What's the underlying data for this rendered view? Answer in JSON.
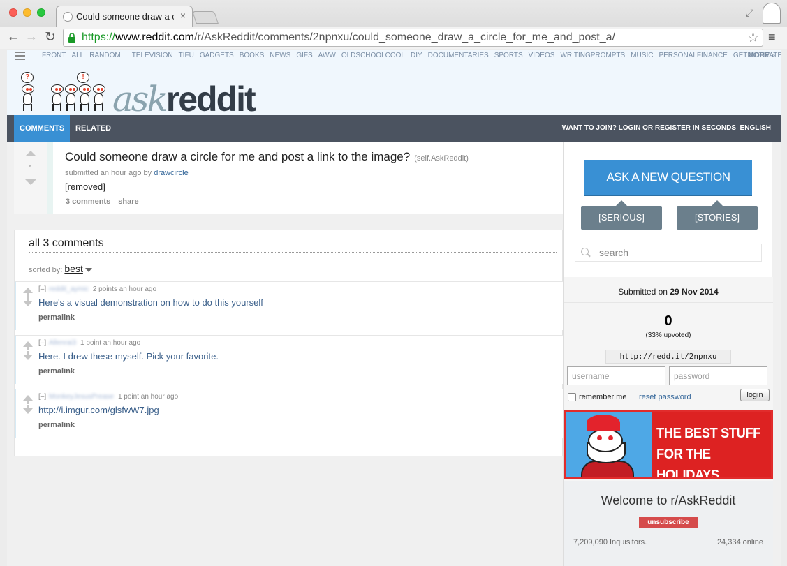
{
  "browser": {
    "tab_title": "Could someone draw a circ",
    "url": {
      "scheme": "https://",
      "host": "www.reddit.com",
      "path": "/r/AskReddit/comments/2npnxu/could_someone_draw_a_circle_for_me_and_post_a/"
    }
  },
  "subreddit_bar": {
    "items": [
      "FRONT",
      "ALL",
      "RANDOM",
      "TELEVISION",
      "TIFU",
      "GADGETS",
      "BOOKS",
      "NEWS",
      "GIFS",
      "AWW",
      "OLDSCHOOLCOOL",
      "DIY",
      "DOCUMENTARIES",
      "SPORTS",
      "VIDEOS",
      "WRITINGPROMPTS",
      "MUSIC",
      "PERSONALFINANCE",
      "GETMOTIVATED"
    ],
    "more": "MORE »"
  },
  "header": {
    "wordmark_ask": "ask",
    "wordmark_reddit": "reddit",
    "tabs": [
      "COMMENTS",
      "RELATED"
    ],
    "join": "WANT TO JOIN? LOGIN OR REGISTER IN SECONDS",
    "language": "ENGLISH"
  },
  "post": {
    "score": "•",
    "title": "Could someone draw a circle for me and post a link to the image?",
    "domain": "(self.AskReddit)",
    "submitted": "submitted an hour ago by",
    "author": "drawcircle",
    "body": "[removed]",
    "comments_link": "3 comments",
    "share_link": "share"
  },
  "comments_area": {
    "heading": "all 3 comments",
    "sorted_by_label": "sorted by:",
    "sort_value": "best",
    "comments": [
      {
        "collapse": "[–]",
        "author": "reddit_aymic",
        "points": "2 points an hour ago",
        "body": "Here's a visual demonstration on how to do this yourself",
        "permalink": "permalink"
      },
      {
        "collapse": "[–]",
        "author": "Allenrai3",
        "points": "1 point an hour ago",
        "body": "Here. I drew these myself. Pick your favorite.",
        "permalink": "permalink"
      },
      {
        "collapse": "[–]",
        "author": "MonkeyJesusPrease",
        "points": "1 point an hour ago",
        "body": "http://i.imgur.com/glsfwW7.jpg",
        "permalink": "permalink"
      }
    ]
  },
  "sidebar": {
    "ask_button": "ASK A NEW QUESTION",
    "serious_button": "[SERIOUS]",
    "stories_button": "[STORIES]",
    "search_placeholder": "search",
    "submitted_label": "Submitted on",
    "submitted_date": "29 Nov 2014",
    "score": "0",
    "upvoted": "(33% upvoted)",
    "shortlink": "http://redd.it/2npnxu",
    "username_placeholder": "username",
    "password_placeholder": "password",
    "remember_me": "remember me",
    "reset_password": "reset password",
    "login_button": "login",
    "holiday_banner_line1": "THE BEST STUFF",
    "holiday_banner_line2": "FOR THE HOLIDAYS",
    "welcome_title": "Welcome to r/AskReddit",
    "unsubscribe": "unsubscribe",
    "subscribers": "7,209,090 Inquisitors.",
    "online": "24,334 online"
  },
  "colors": {
    "accent_blue": "#3990d4",
    "tab_bar": "#4b5360",
    "unsubscribe_red": "#d54b4b",
    "https_green": "#1a9a28"
  },
  "icons": [
    "back-icon",
    "forward-icon",
    "reload-icon",
    "lock-icon",
    "star-icon",
    "menu-icon",
    "search-icon",
    "upvote-icon",
    "downvote-icon",
    "sort-caret-icon"
  ]
}
